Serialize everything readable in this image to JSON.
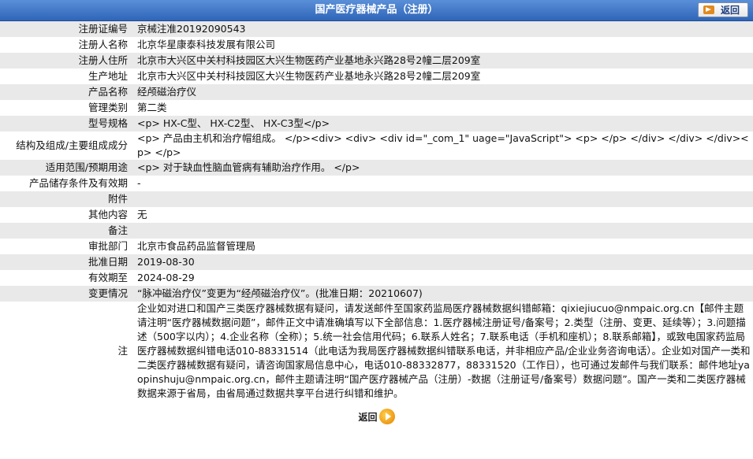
{
  "header": {
    "title": "国产医疗器械产品（注册）",
    "back_label": "返回"
  },
  "rows": [
    {
      "label": "注册证编号",
      "value": "京械注准20192090543"
    },
    {
      "label": "注册人名称",
      "value": "北京华星康泰科技发展有限公司"
    },
    {
      "label": "注册人住所",
      "value": "北京市大兴区中关村科技园区大兴生物医药产业基地永兴路28号2幢二层209室"
    },
    {
      "label": "生产地址",
      "value": "北京市大兴区中关村科技园区大兴生物医药产业基地永兴路28号2幢二层209室"
    },
    {
      "label": "产品名称",
      "value": "经颅磁治疗仪"
    },
    {
      "label": "管理类别",
      "value": "第二类"
    },
    {
      "label": "型号规格",
      "value": "<p> HX-C型、 HX-C2型、 HX-C3型</p>"
    },
    {
      "label": "结构及组成/主要组成成分",
      "value": "<p> 产品由主机和治疗帽组成。 </p><div> <div> <div id=\"_com_1\" uage=\"JavaScript\"> <p> </p> </div> </div> </div><p> </p>"
    },
    {
      "label": "适用范围/预期用途",
      "value": "<p> 对于缺血性脑血管病有辅助治疗作用。 </p>"
    },
    {
      "label": "产品储存条件及有效期",
      "value": "-"
    },
    {
      "label": "附件",
      "value": ""
    },
    {
      "label": "其他内容",
      "value": "无"
    },
    {
      "label": "备注",
      "value": ""
    },
    {
      "label": "审批部门",
      "value": "北京市食品药品监督管理局"
    },
    {
      "label": "批准日期",
      "value": "2019-08-30"
    },
    {
      "label": "有效期至",
      "value": "2024-08-29"
    },
    {
      "label": "变更情况",
      "value": "“脉冲磁治疗仪”变更为“经颅磁治疗仪”。(批准日期：20210607)"
    }
  ],
  "note": {
    "label": "注",
    "text": "企业如对进口和国产三类医疗器械数据有疑问，请发送邮件至国家药监局医疗器械数据纠错邮箱：qixiejiucuo@nmpaic.org.cn【邮件主题请注明“医疗器械数据问题”，邮件正文中请准确填写以下全部信息：1.医疗器械注册证号/备案号；2.类型（注册、变更、延续等）；3.问题描述（500字以内）；4.企业名称（全称）；5.统一社会信用代码；6.联系人姓名；7.联系电话（手机和座机）；8.联系邮箱】，或致电国家药监局医疗器械数据纠错电话010-88331514（此电话为我局医疗器械数据纠错联系电话，并非相应产品/企业业务咨询电话）。企业如对国产一类和二类医疗器械数据有疑问，请咨询国家局信息中心，电话010-88332877，88331520（工作日），也可通过发邮件与我们联系：邮件地址yaopinshuju@nmpaic.org.cn，邮件主题请注明“国产医疗器械产品（注册）-数据（注册证号/备案号）数据问题”。国产一类和二类医疗器械数据来源于省局，由省局通过数据共享平台进行纠错和维护。"
  },
  "footer": {
    "back_label": "返回"
  }
}
